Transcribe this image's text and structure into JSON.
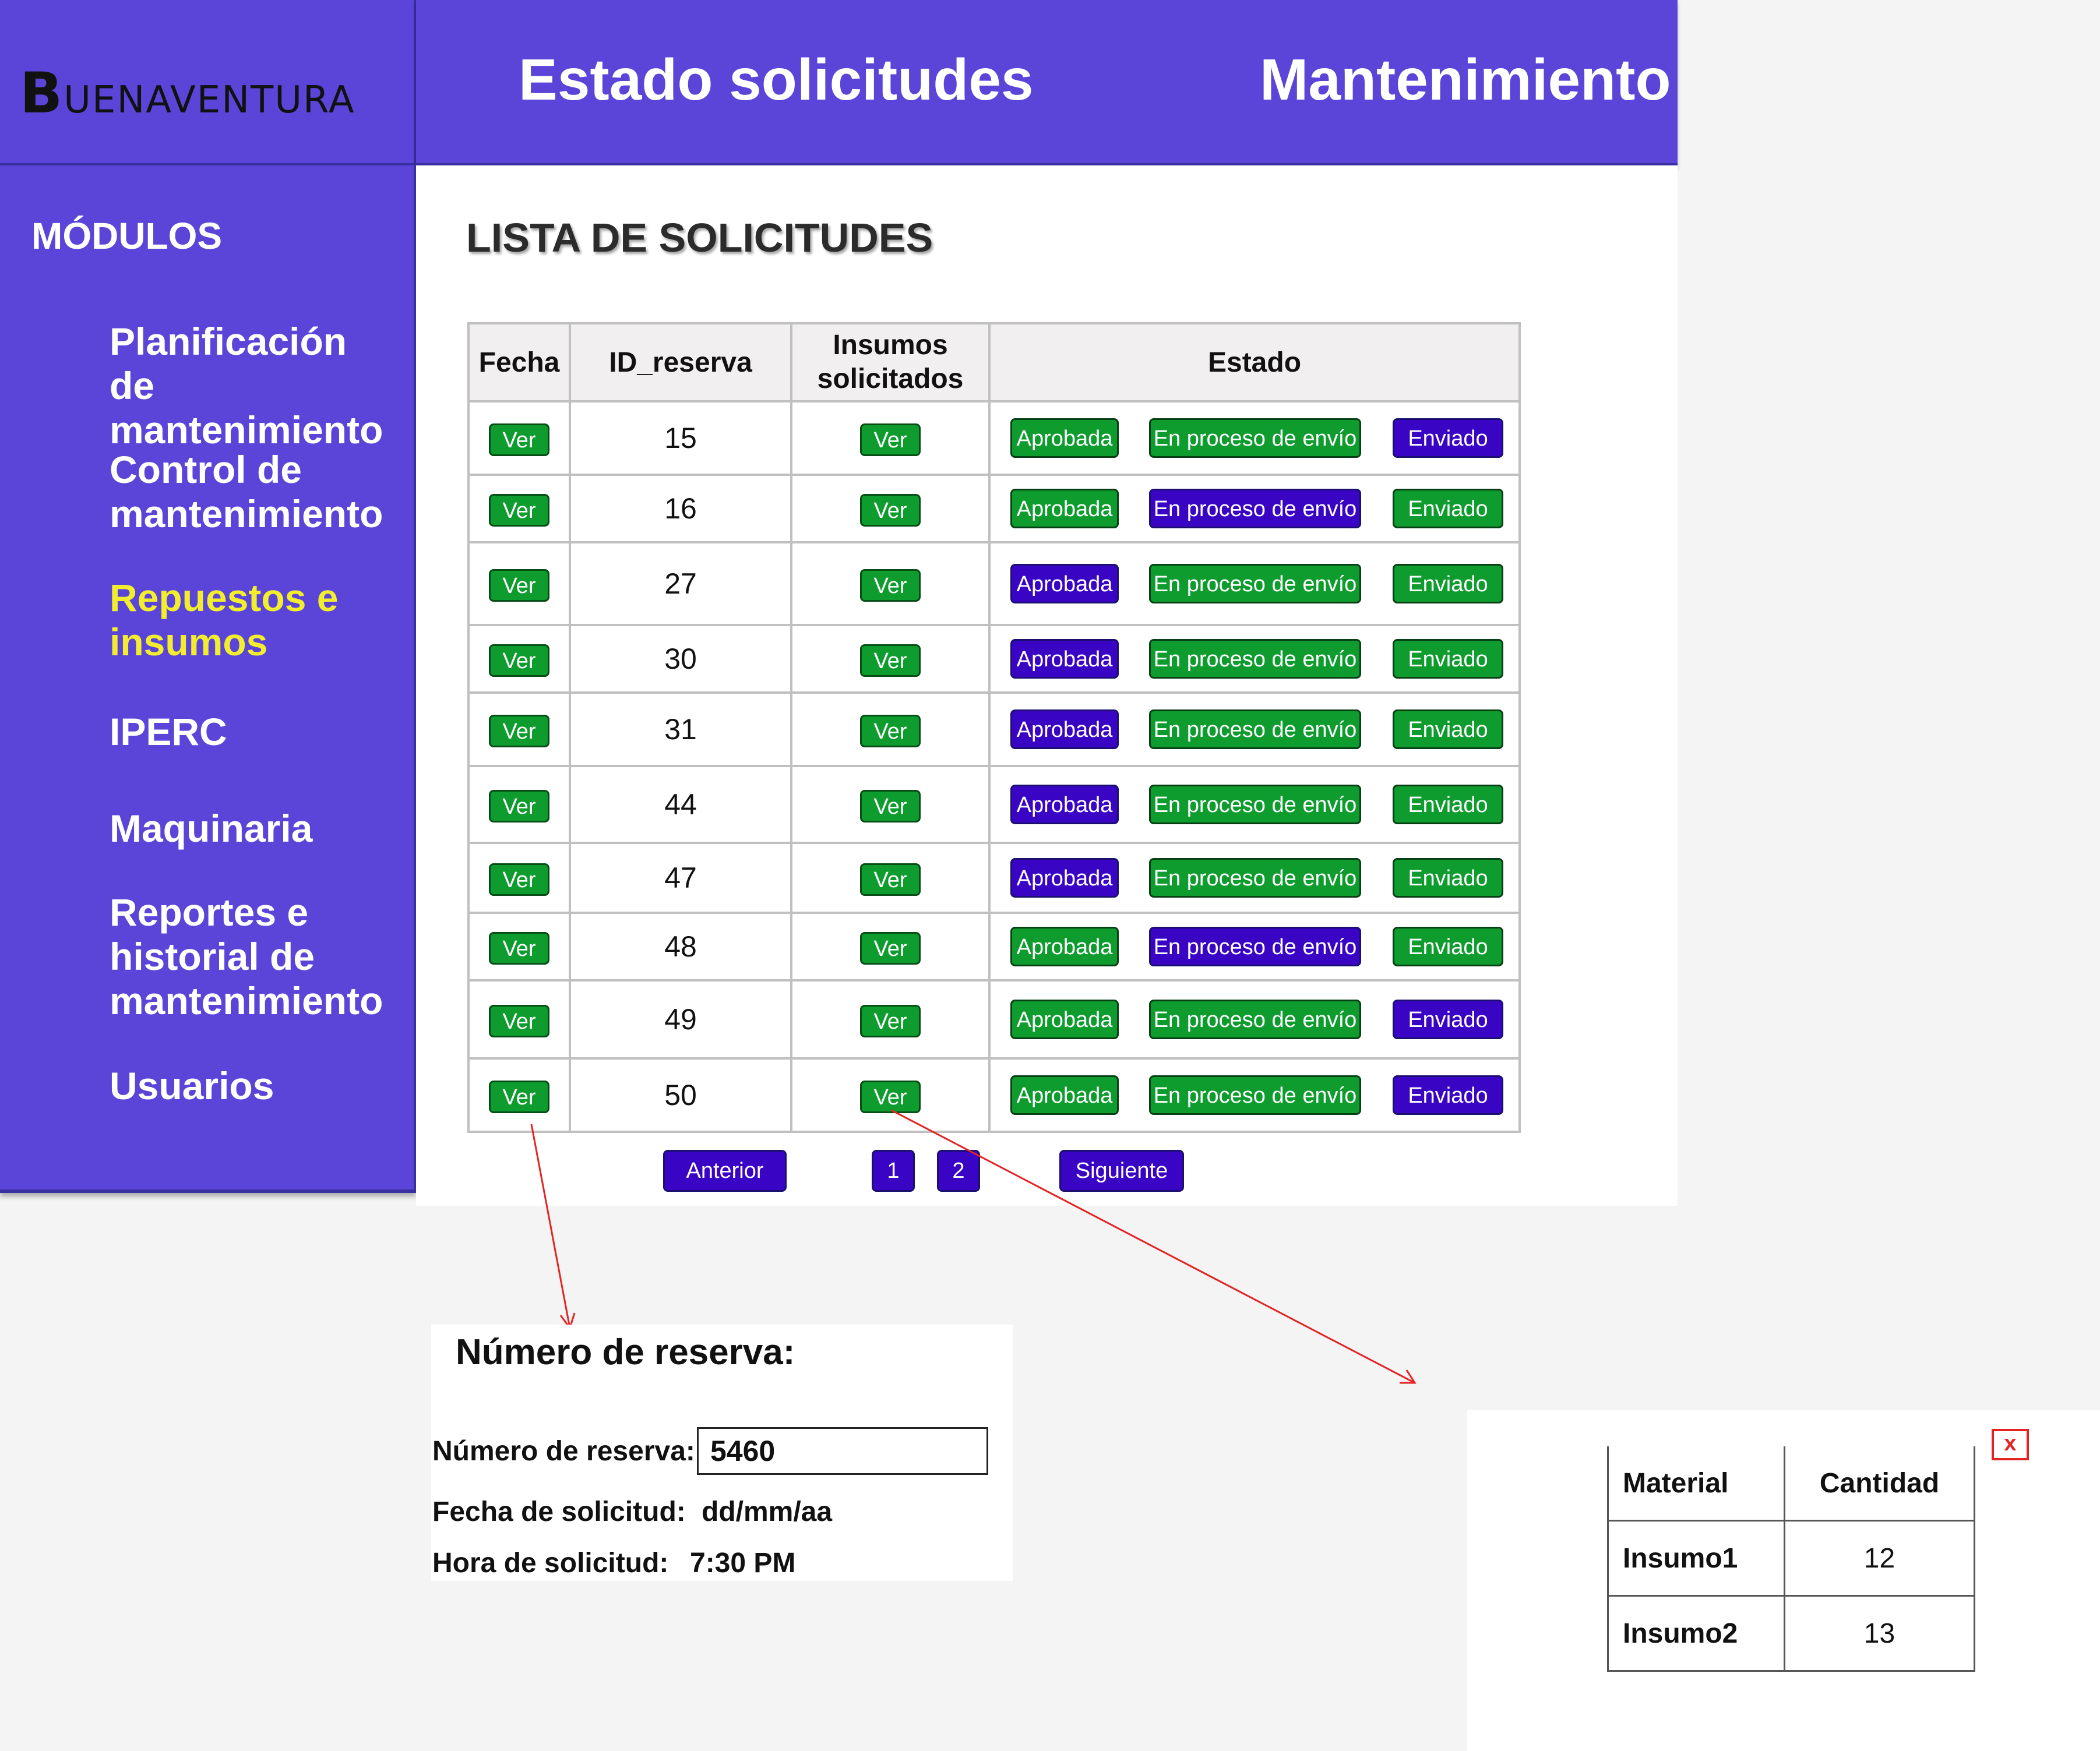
{
  "brand": {
    "logo_initial": "B",
    "logo_rest": "UENAVENTURA"
  },
  "header": {
    "title": "Estado solicitudes",
    "section": "Mantenimiento"
  },
  "sidebar": {
    "title": "MÓDULOS",
    "items": [
      {
        "label": "Planificación de mantenimiento"
      },
      {
        "label": "Control de mantenimiento"
      },
      {
        "label": "Repuestos e insumos",
        "active": true
      },
      {
        "label": "IPERC"
      },
      {
        "label": "Maquinaria"
      },
      {
        "label": "Reportes e historial de mantenimiento"
      },
      {
        "label": "Usuarios"
      }
    ]
  },
  "main": {
    "heading": "LISTA DE SOLICITUDES",
    "columns": {
      "fecha": "Fecha",
      "id": "ID_reserva",
      "insumos": "Insumos solicitados",
      "estado": "Estado"
    },
    "ver_label": "Ver",
    "state_labels": [
      "Aprobada",
      "En proceso de envío",
      "Enviado"
    ],
    "rows": [
      {
        "id": "15",
        "active_state": 2
      },
      {
        "id": "16",
        "active_state": 1
      },
      {
        "id": "27",
        "active_state": 0
      },
      {
        "id": "30",
        "active_state": 0
      },
      {
        "id": "31",
        "active_state": 0
      },
      {
        "id": "44",
        "active_state": 0
      },
      {
        "id": "47",
        "active_state": 0
      },
      {
        "id": "48",
        "active_state": 1
      },
      {
        "id": "49",
        "active_state": 2
      },
      {
        "id": "50",
        "active_state": 2
      }
    ],
    "pagination": {
      "prev": "Anterior",
      "pages": [
        "1",
        "2"
      ],
      "next": "Siguiente"
    }
  },
  "detail": {
    "title": "Número de reserva:",
    "reserva_label": "Número de reserva:",
    "reserva_value": "5460",
    "fecha_label": "Fecha de solicitud:",
    "fecha_value": "dd/mm/aa",
    "hora_label": "Hora de solicitud:",
    "hora_value": "7:30 PM"
  },
  "materials": {
    "close_label": "x",
    "headers": [
      "Material",
      "Cantidad"
    ],
    "rows": [
      {
        "material": "Insumo1",
        "cantidad": "12"
      },
      {
        "material": "Insumo2",
        "cantidad": "13"
      }
    ]
  },
  "colors": {
    "primary": "#5b45d8",
    "active_state": "#3a04c4",
    "inactive_state": "#0f9c2e",
    "active_menu": "#f2ee2e",
    "annotation": "#e22424"
  }
}
